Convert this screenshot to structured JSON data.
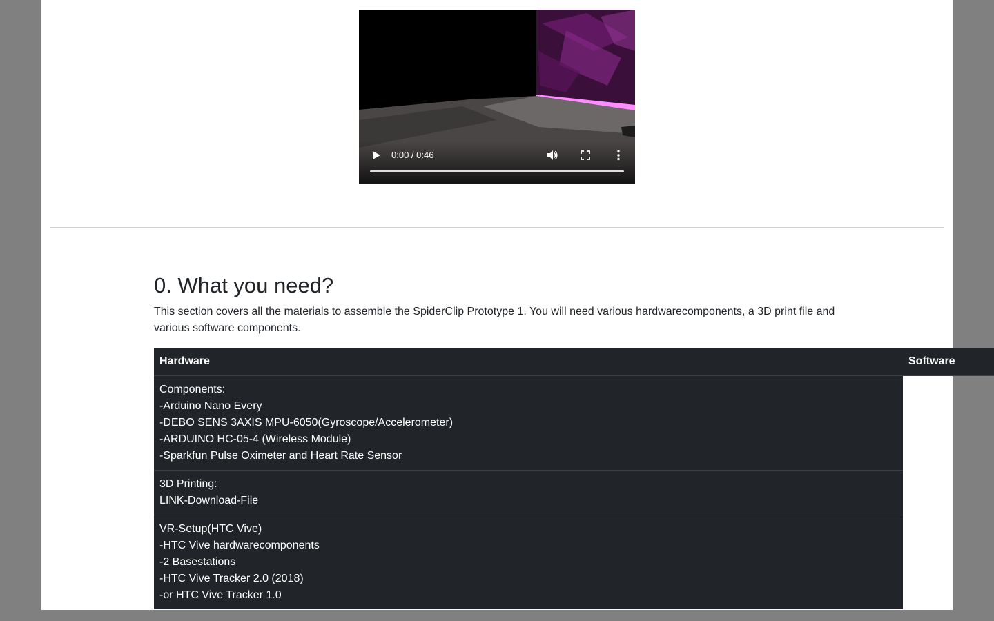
{
  "video": {
    "time_display": "0:00 / 0:46",
    "progress": 0,
    "controls": {
      "play_icon": "play-icon",
      "volume_icon": "volume-icon",
      "fullscreen_icon": "fullscreen-icon",
      "more_icon": "more-vertical-icon"
    }
  },
  "section": {
    "heading": "0. What you need?",
    "intro": "This section covers all the materials to assemble the SpiderClip Prototype 1. You will need various hardwarecomponents, a 3D print file and various software components."
  },
  "table": {
    "headers": [
      "Hardware",
      "Software"
    ],
    "rows": [
      {
        "lines": [
          "Components:",
          "-Arduino Nano Every",
          "-DEBO SENS 3AXIS MPU-6050(Gyroscope/Accelerometer)",
          "-ARDUINO HC-05-4 (Wireless Module)",
          "-Sparkfun Pulse Oximeter and Heart Rate Sensor"
        ]
      },
      {
        "lines": [
          "3D Printing:",
          "LINK-Download-File"
        ]
      },
      {
        "lines": [
          "VR-Setup(HTC Vive)",
          "-HTC Vive hardwarecomponents",
          "-2 Basestations",
          "-HTC Vive Tracker 2.0 (2018)",
          "-or HTC Vive Tracker 1.0"
        ]
      }
    ]
  },
  "colors": {
    "page_bg": "#ffffff",
    "outer_bg": "#808080",
    "table_bg": "#212529",
    "accent_magenta": "#c04ac0"
  }
}
